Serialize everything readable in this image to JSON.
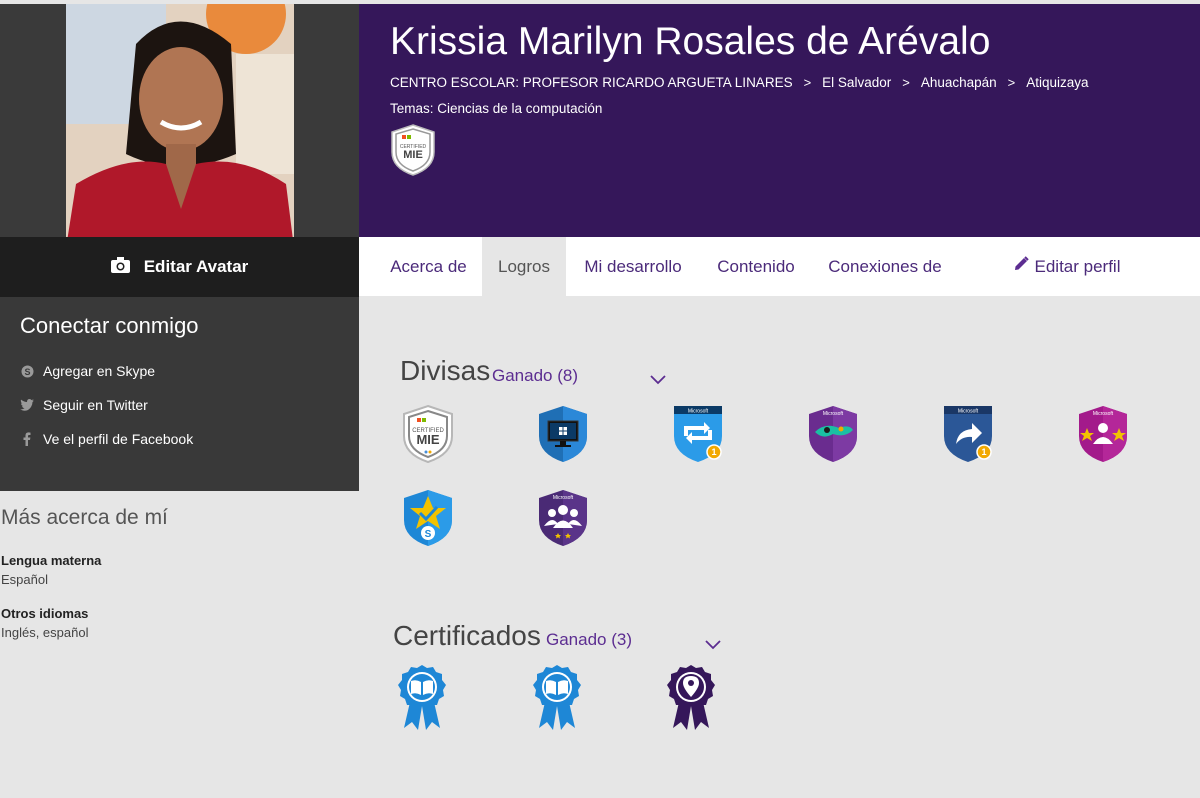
{
  "profile": {
    "name": "Krissia Marilyn Rosales de Arévalo",
    "breadcrumb": [
      "CENTRO ESCOLAR: PROFESOR RICARDO ARGUETA LINARES",
      "El Salvador",
      "Ahuachapán",
      "Atiquizaya"
    ],
    "topics": "Temas: Ciencias de la computación",
    "header_badge": "CERTIFIED MIE"
  },
  "left": {
    "edit_avatar": "Editar Avatar",
    "connect_title": "Conectar conmigo",
    "connect_items": [
      "Agregar en Skype",
      "Seguir en Twitter",
      "Ve el perfil de Facebook"
    ],
    "more_title": "Más acerca de mí",
    "fields": [
      {
        "label": "Lengua materna",
        "value": "Español"
      },
      {
        "label": "Otros idiomas",
        "value": "Inglés, español"
      }
    ]
  },
  "tabs": {
    "items": [
      "Acerca de",
      "Logros",
      "Mi desarrollo",
      "Contenido",
      "Conexiones de"
    ],
    "active": "Logros",
    "edit_label": "Editar perfil"
  },
  "sections": {
    "badges": {
      "title": "Divisas",
      "count": "Ganado (8)"
    },
    "certificates": {
      "title": "Certificados",
      "count": "Ganado (3)"
    }
  },
  "badge_list": [
    "certified-mie",
    "windows-monitor",
    "retweet",
    "teal-microsoft",
    "share-arrow",
    "stars-people",
    "skype-star",
    "people-group"
  ],
  "cert_list": [
    "book-ribbon",
    "book-ribbon",
    "location-ribbon"
  ],
  "colors": {
    "header_bg": "#35175a",
    "accent": "#5c2d91",
    "page_bg": "#e6e6e6"
  }
}
